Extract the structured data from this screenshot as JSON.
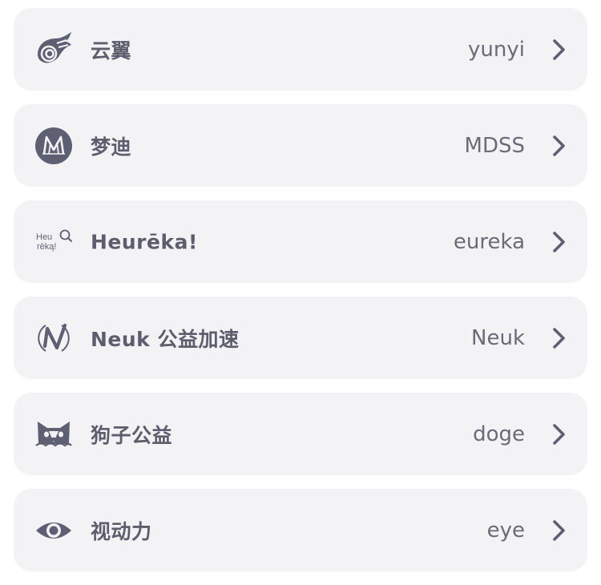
{
  "colors": {
    "row_background": "#f3f3f6",
    "text": "#5d5d6e",
    "icon": "#5f5f73"
  },
  "services": [
    {
      "icon": "wing-swirl-icon",
      "name": "云翼",
      "code": "yunyi"
    },
    {
      "icon": "m-logo-icon",
      "name": "梦迪",
      "code": "MDSS"
    },
    {
      "icon": "heureka-logo-icon",
      "name": "Heurēka!",
      "code": "eureka",
      "logo_text_1": "Heu",
      "logo_text_2": "rēką!"
    },
    {
      "icon": "neuk-logo-icon",
      "name": "Neuk 公益加速",
      "code": "Neuk"
    },
    {
      "icon": "dog-face-icon",
      "name": "狗子公益",
      "code": "doge"
    },
    {
      "icon": "eye-icon",
      "name": "视动力",
      "code": "eye"
    }
  ]
}
